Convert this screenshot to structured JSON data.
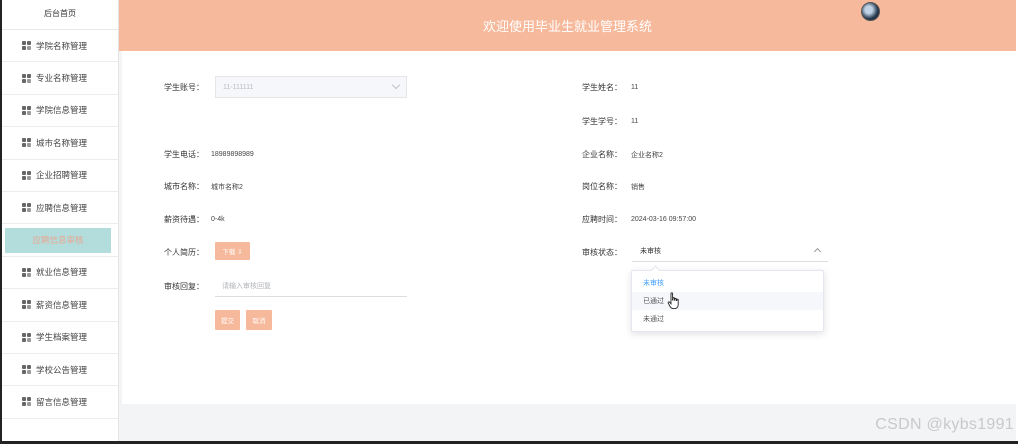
{
  "header": {
    "title": "欢迎使用毕业生就业管理系统"
  },
  "sidebar": {
    "home_label": "后台首页",
    "items": [
      {
        "label": "学院名称管理"
      },
      {
        "label": "专业名称管理"
      },
      {
        "label": "学院信息管理"
      },
      {
        "label": "城市名称管理"
      },
      {
        "label": "企业招聘管理"
      },
      {
        "label": "应聘信息管理"
      },
      {
        "label": "应聘信息审核",
        "active": true
      },
      {
        "label": "就业信息管理"
      },
      {
        "label": "薪资信息管理"
      },
      {
        "label": "学生档案管理"
      },
      {
        "label": "学校公告管理"
      },
      {
        "label": "留言信息管理"
      }
    ]
  },
  "form": {
    "student_account": {
      "label": "学生账号：",
      "value": "11-111111"
    },
    "student_name": {
      "label": "学生姓名：",
      "value": "11"
    },
    "student_no": {
      "label": "学生学号：",
      "value": "11"
    },
    "student_phone": {
      "label": "学生电话：",
      "value": "18989898989"
    },
    "company_name": {
      "label": "企业名称：",
      "value": "企业名称2"
    },
    "city_name": {
      "label": "城市名称：",
      "value": "城市名称2"
    },
    "position_name": {
      "label": "岗位名称：",
      "value": "销售"
    },
    "salary": {
      "label": "薪资待遇：",
      "value": "0-4k"
    },
    "apply_time": {
      "label": "应聘时间：",
      "value": "2024-03-16 09:57:00"
    },
    "resume": {
      "label": "个人简历：",
      "button": "下载 ⇩"
    },
    "review_status": {
      "label": "审核状态：",
      "value": "未审核"
    },
    "review_reply": {
      "label": "审核回复：",
      "placeholder": "请输入审核回复"
    },
    "submit_label": "提交",
    "cancel_label": "取消"
  },
  "status_dropdown": {
    "options": [
      "未审核",
      "已通过",
      "未通过"
    ],
    "selected_index": 0,
    "hovered_index": 1
  },
  "watermark": "CSDN @kybs1991",
  "colors": {
    "accent": "#f7b99b",
    "active_menu_bg": "#b3dcdc",
    "selected_option": "#409eff"
  }
}
